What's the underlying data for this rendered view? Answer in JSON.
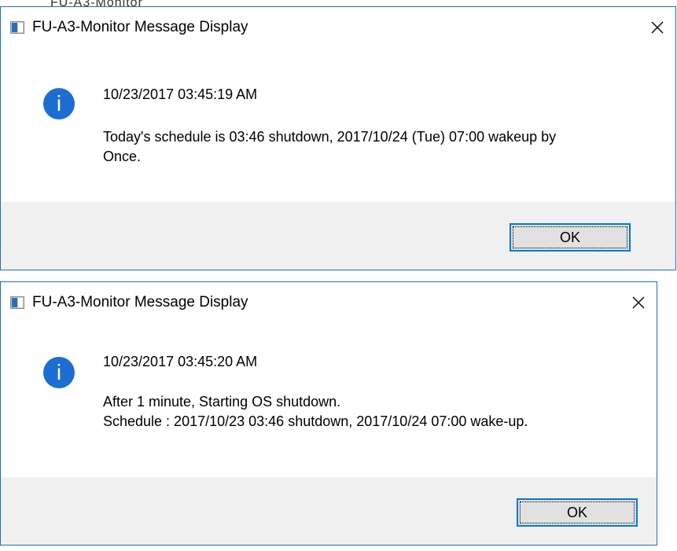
{
  "background_fragment": "FU-A3-Monitor",
  "dialogs": [
    {
      "title": "FU-A3-Monitor Message Display",
      "timestamp": "10/23/2017 03:45:19 AM",
      "message": "Today's schedule is 03:46 shutdown, 2017/10/24 (Tue) 07:00 wakeup by\nOnce.",
      "ok_label": "OK",
      "close_glyph": "✕"
    },
    {
      "title": "FU-A3-Monitor Message Display",
      "timestamp": "10/23/2017 03:45:20 AM",
      "message": "After 1 minute, Starting OS shutdown.\nSchedule : 2017/10/23 03:46 shutdown, 2017/10/24 07:00 wake-up.",
      "ok_label": "OK",
      "close_glyph": "✕"
    }
  ],
  "icons": {
    "info": "i",
    "app": "app-window-icon",
    "close": "close-icon"
  },
  "colors": {
    "accent_border": "#1a6fc4",
    "info_icon": "#1c6ed3",
    "footer_bg": "#f0f0f0",
    "button_bg": "#e1e1e1",
    "button_focus_border": "#0078d7"
  }
}
